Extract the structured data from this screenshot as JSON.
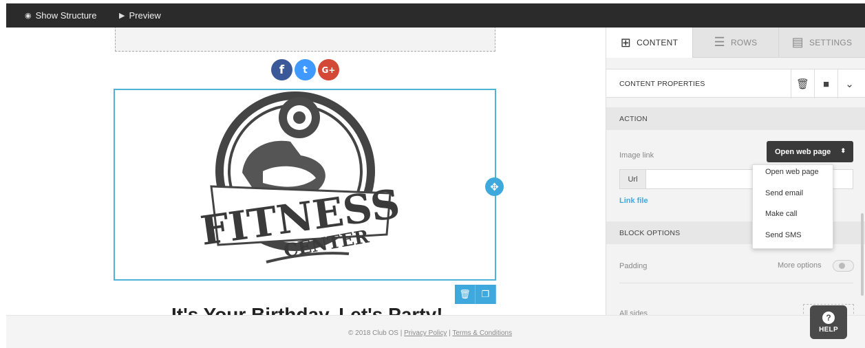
{
  "topbar": {
    "show_structure": "Show Structure",
    "show_structure_icon": "eye-icon",
    "preview": "Preview",
    "preview_icon": "play-circle-icon"
  },
  "canvas": {
    "social_icons": [
      "f",
      "t",
      "G+"
    ],
    "logo_text_main": "FITNESS",
    "logo_text_sub": "CENTER",
    "headline": "It's Your Birthday, Let's Party!"
  },
  "footer": {
    "copyright": "© 2018 Club OS |",
    "privacy": "Privacy Policy",
    "separator": "|",
    "terms": "Terms & Conditions"
  },
  "sidebar": {
    "tabs": [
      {
        "label": "CONTENT",
        "icon": "grid-icon"
      },
      {
        "label": "ROWS",
        "icon": "rows-icon"
      },
      {
        "label": "SETTINGS",
        "icon": "settings-icon"
      }
    ],
    "content_properties": "CONTENT PROPERTIES",
    "action_header": "ACTION",
    "image_link_label": "Image link",
    "image_link_value": "Open web page",
    "url_prefix": "Url",
    "link_file": "Link file",
    "block_options_header": "BLOCK OPTIONS",
    "padding_label": "Padding",
    "more_options": "More options",
    "all_sides": "All sides"
  },
  "dropdown": {
    "options": [
      "Open web page",
      "Send email",
      "Make call",
      "Send SMS"
    ]
  },
  "help": {
    "label": "HELP",
    "icon": "?"
  },
  "colors": {
    "accent": "#3fa9dd",
    "topbar": "#2b2b2b",
    "facebook": "#3b5998",
    "twitter": "#4099ff",
    "google_plus": "#d34836"
  }
}
